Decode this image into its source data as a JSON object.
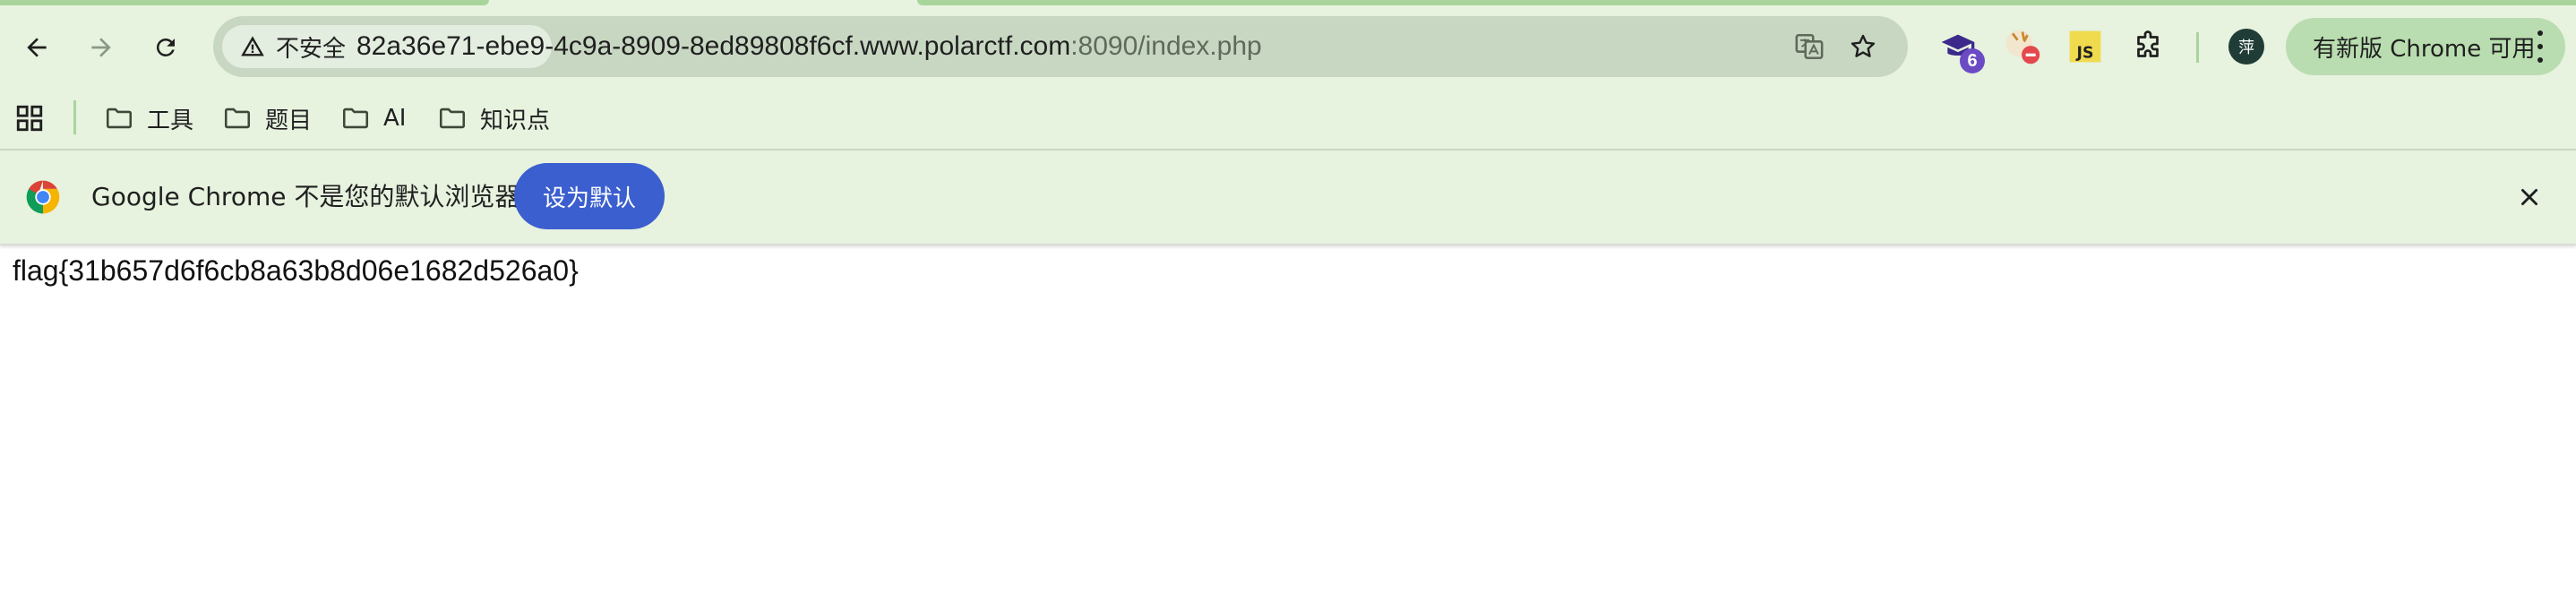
{
  "browser": {
    "security_label": "不安全",
    "url_host": "82a36e71-ebe9-4c9a-8909-8ed89808f6cf.www.polarctf.com",
    "url_rest": ":8090/index.php",
    "extension_badge": "6",
    "avatar_initial": "萍",
    "update_label": "有新版 Chrome 可用"
  },
  "bookmarks": [
    {
      "label": "工具"
    },
    {
      "label": "题目"
    },
    {
      "label": "AI"
    },
    {
      "label": "知识点"
    }
  ],
  "infobar": {
    "message": "Google Chrome 不是您的默认浏览器",
    "button": "设为默认"
  },
  "page": {
    "body_text": "flag{31b657d6f6cb8a63b8d06e1682d526a0}"
  },
  "colors": {
    "toolbar_bg": "#e7f2df",
    "omnibox_bg": "#c8d7c2",
    "accent_green": "#a8d59c",
    "primary_button": "#3b5fcf"
  }
}
